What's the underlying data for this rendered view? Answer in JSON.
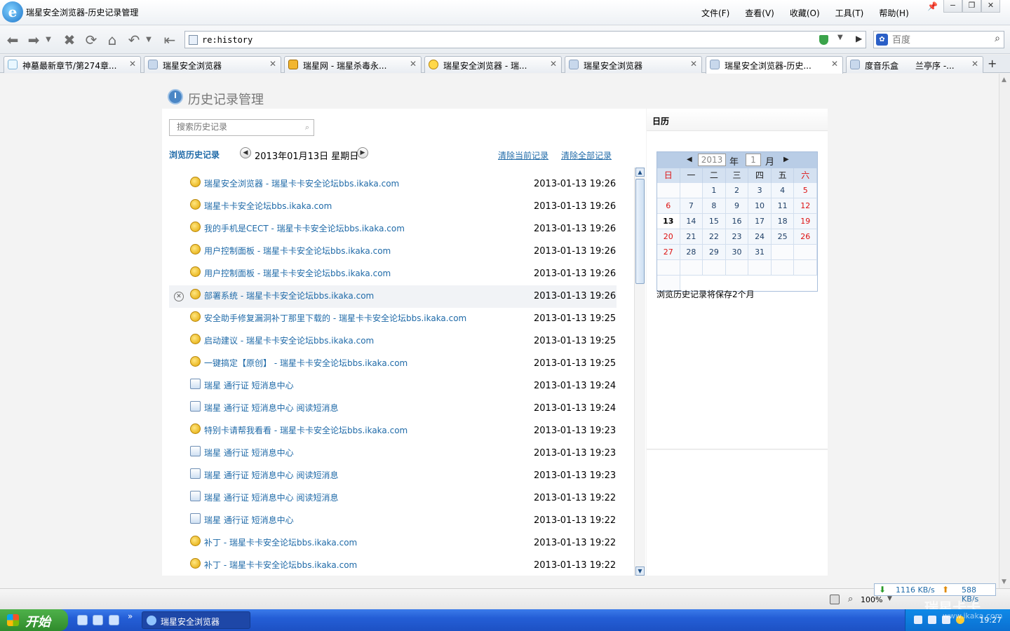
{
  "window": {
    "title": "瑞星安全浏览器-历史记录管理",
    "menu": [
      "文件(F)",
      "查看(V)",
      "收藏(O)",
      "工具(T)",
      "帮助(H)"
    ],
    "controls": [
      "−",
      "❐",
      "✕"
    ]
  },
  "nav": {
    "address": "re:history",
    "search_placeholder": "百度"
  },
  "tabs": [
    {
      "label": "神墓最新章节/第274章..."
    },
    {
      "label": "瑞星安全浏览器"
    },
    {
      "label": "瑞星网 - 瑞星杀毒永..."
    },
    {
      "label": "瑞星安全浏览器 - 瑞..."
    },
    {
      "label": "瑞星安全浏览器"
    },
    {
      "label": "瑞星安全浏览器-历史..."
    },
    {
      "label": "度音乐盒　　兰亭序 -..."
    }
  ],
  "page": {
    "title": "历史记录管理",
    "search_placeholder": "搜索历史记录",
    "section_label": "浏览历史记录",
    "current_date": "2013年01月13日 星期日",
    "clear_current": "清除当前记录",
    "clear_all": "清除全部记录"
  },
  "history": [
    {
      "title": "瑞星安全浏览器  - 瑞星卡卡安全论坛bbs.ikaka.com",
      "time": "2013-01-13 19:26",
      "icon": "rising-favicon"
    },
    {
      "title": "瑞星卡卡安全论坛bbs.ikaka.com",
      "time": "2013-01-13 19:26",
      "icon": "rising-favicon"
    },
    {
      "title": "我的手机是CECT - 瑞星卡卡安全论坛bbs.ikaka.com",
      "time": "2013-01-13 19:26",
      "icon": "rising-favicon"
    },
    {
      "title": "用户控制面板  - 瑞星卡卡安全论坛bbs.ikaka.com",
      "time": "2013-01-13 19:26",
      "icon": "rising-favicon"
    },
    {
      "title": "用户控制面板  - 瑞星卡卡安全论坛bbs.ikaka.com",
      "time": "2013-01-13 19:26",
      "icon": "rising-favicon"
    },
    {
      "title": "部署系统  - 瑞星卡卡安全论坛bbs.ikaka.com",
      "time": "2013-01-13 19:26",
      "icon": "rising-favicon"
    },
    {
      "title": "安全助手修复漏洞补丁那里下载的  - 瑞星卡卡安全论坛bbs.ikaka.com",
      "time": "2013-01-13 19:25",
      "icon": "rising-favicon"
    },
    {
      "title": "启动建议  - 瑞星卡卡安全论坛bbs.ikaka.com",
      "time": "2013-01-13 19:25",
      "icon": "rising-favicon"
    },
    {
      "title": "一键搞定【原创】  - 瑞星卡卡安全论坛bbs.ikaka.com",
      "time": "2013-01-13 19:25",
      "icon": "rising-favicon"
    },
    {
      "title": "瑞星  通行证  短消息中心",
      "time": "2013-01-13 19:24",
      "icon": "page-icon"
    },
    {
      "title": "瑞星  通行证  短消息中心  阅读短消息",
      "time": "2013-01-13 19:24",
      "icon": "page-icon"
    },
    {
      "title": "特别卡请帮我看看  - 瑞星卡卡安全论坛bbs.ikaka.com",
      "time": "2013-01-13 19:23",
      "icon": "rising-favicon"
    },
    {
      "title": "瑞星  通行证  短消息中心",
      "time": "2013-01-13 19:23",
      "icon": "page-icon"
    },
    {
      "title": "瑞星  通行证  短消息中心  阅读短消息",
      "time": "2013-01-13 19:23",
      "icon": "page-icon"
    },
    {
      "title": "瑞星  通行证  短消息中心  阅读短消息",
      "time": "2013-01-13 19:22",
      "icon": "page-icon"
    },
    {
      "title": "瑞星  通行证  短消息中心",
      "time": "2013-01-13 19:22",
      "icon": "page-icon"
    },
    {
      "title": "补丁  - 瑞星卡卡安全论坛bbs.ikaka.com",
      "time": "2013-01-13 19:22",
      "icon": "rising-favicon"
    },
    {
      "title": "补丁  - 瑞星卡卡安全论坛bbs.ikaka.com",
      "time": "2013-01-13 19:22",
      "icon": "rising-favicon"
    }
  ],
  "sidebar": {
    "title": "日历",
    "calendar": {
      "year": "2013",
      "year_label": "年",
      "month": "1",
      "month_label": "月",
      "weekdays": [
        "日",
        "一",
        "二",
        "三",
        "四",
        "五",
        "六"
      ],
      "cells": [
        "",
        "",
        "1",
        "2",
        "3",
        "4",
        "5",
        "6",
        "7",
        "8",
        "9",
        "10",
        "11",
        "12",
        "13",
        "14",
        "15",
        "16",
        "17",
        "18",
        "19",
        "20",
        "21",
        "22",
        "23",
        "24",
        "25",
        "26",
        "27",
        "28",
        "29",
        "30",
        "31",
        "",
        "",
        "",
        "",
        "",
        "",
        "",
        "",
        "",
        ""
      ],
      "today": "13"
    },
    "note": "浏览历史记录将保存2个月"
  },
  "status": {
    "zoom": "100%",
    "download_speed": "1116 KB/s",
    "upload_speed": "588 KB/s"
  },
  "taskbar": {
    "start_label": "开始",
    "task_label": "瑞星安全浏览器",
    "clock": "19:27",
    "watermark": "瑞星卡卡",
    "watermark_url": "www.ikaka.com"
  },
  "colors": {
    "link": "#1f6aa8",
    "weekend": "#d11111",
    "taskbar": "#245ed6"
  }
}
